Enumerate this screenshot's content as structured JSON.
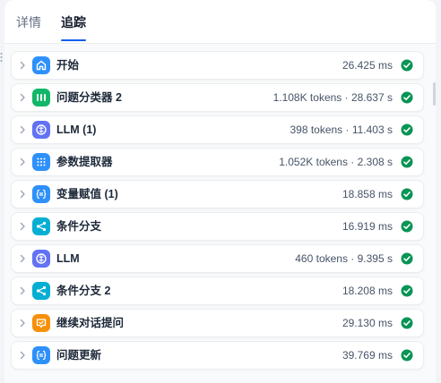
{
  "tabs": {
    "details": "详情",
    "tracing": "追踪"
  },
  "colors": {
    "home": "#2e90fa",
    "classifier": "#12b76a",
    "llm": "#6172f3",
    "extractor": "#2e90fa",
    "assigner": "#2e90fa",
    "ifelse": "#06aed4",
    "question": "#f79009",
    "success": "#079455"
  },
  "nodes": [
    {
      "name": "开始",
      "meta": "26.425 ms",
      "icon": "home-icon",
      "status": "success"
    },
    {
      "name": "问题分类器 2",
      "meta": "1.108K tokens · 28.637 s",
      "icon": "question-classifier-icon",
      "status": "success"
    },
    {
      "name": "LLM (1)",
      "meta": "398 tokens · 11.403 s",
      "icon": "llm-icon",
      "status": "success"
    },
    {
      "name": "参数提取器",
      "meta": "1.052K tokens · 2.308 s",
      "icon": "parameter-extractor-icon",
      "status": "success"
    },
    {
      "name": "变量赋值 (1)",
      "meta": "18.858 ms",
      "icon": "variable-assigner-icon",
      "status": "success"
    },
    {
      "name": "条件分支",
      "meta": "16.919 ms",
      "icon": "if-else-icon",
      "status": "success"
    },
    {
      "name": "LLM",
      "meta": "460 tokens · 9.395 s",
      "icon": "llm-icon",
      "status": "success"
    },
    {
      "name": "条件分支 2",
      "meta": "18.208 ms",
      "icon": "if-else-icon",
      "status": "success"
    },
    {
      "name": "继续对话提问",
      "meta": "29.130 ms",
      "icon": "question-icon",
      "status": "success"
    },
    {
      "name": "问题更新",
      "meta": "39.769 ms",
      "icon": "variable-assigner-icon",
      "status": "success"
    }
  ]
}
